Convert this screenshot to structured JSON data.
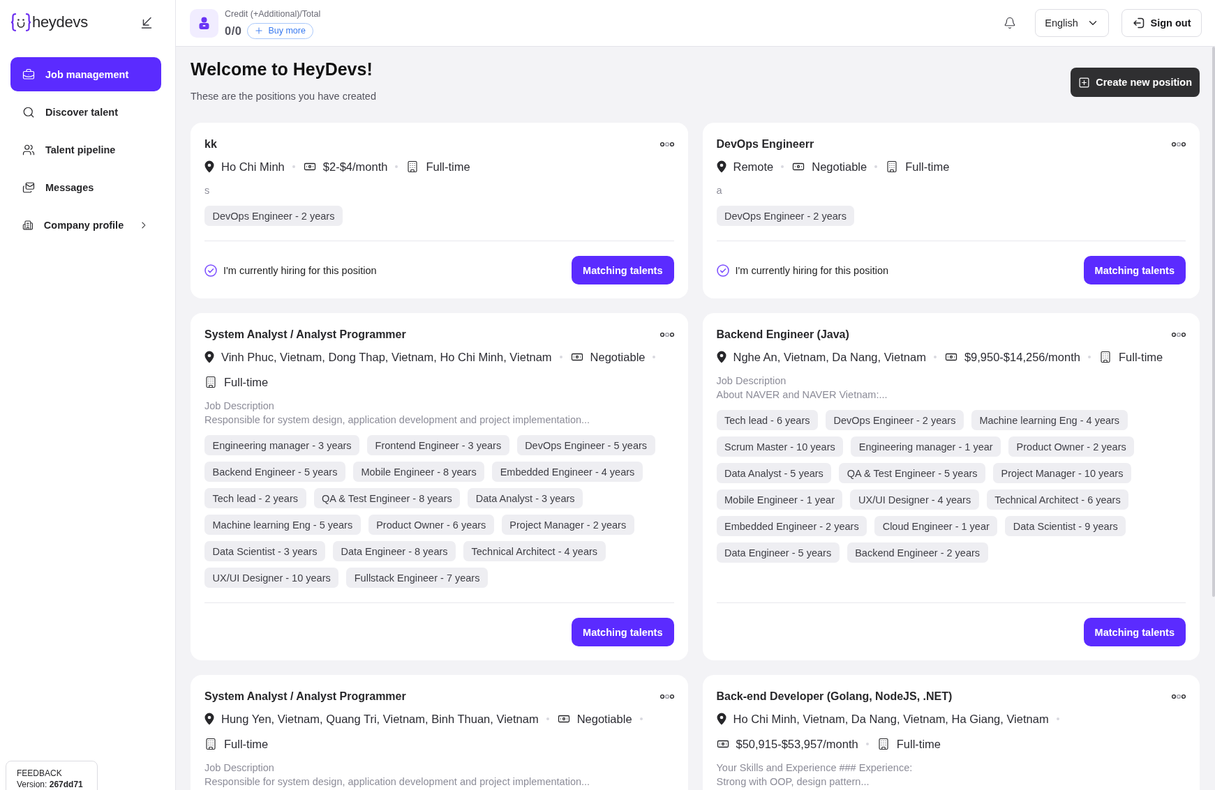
{
  "sidebar": {
    "brand": "heydevs",
    "items": [
      {
        "label": "Job management",
        "selected": true,
        "has_submenu": false
      },
      {
        "label": "Discover talent",
        "selected": false,
        "has_submenu": false
      },
      {
        "label": "Talent pipeline",
        "selected": false,
        "has_submenu": false
      },
      {
        "label": "Messages",
        "selected": false,
        "has_submenu": false
      },
      {
        "label": "Company profile",
        "selected": false,
        "has_submenu": true
      }
    ],
    "feedback": {
      "label": "FEEDBACK",
      "version": "Version: **267dd71**"
    }
  },
  "top_bar": {
    "credit": {
      "label": "Credit (+Additional)/Total",
      "value": "0/0",
      "buy_button": "Buy more"
    },
    "language": "English",
    "sign_out": "Sign out"
  },
  "header": {
    "title": "Welcome to HeyDevs!",
    "subtitle": "These are the positions you have created",
    "create_button": "Create new position"
  },
  "positions": [
    {
      "title": "kk",
      "meta": [
        {
          "kind": "location",
          "text": "Ho Chi Minh"
        },
        {
          "kind": "salary",
          "text": "$2-$4/month"
        },
        {
          "kind": "schedule",
          "text": "Full-time"
        }
      ],
      "description": "s",
      "skills": [
        "DevOps Engineer - 2 years"
      ],
      "hiring": {
        "label": "I'm currently hiring for this position",
        "checked": true
      },
      "button": "Matching talents"
    },
    {
      "title": "DevOps Engineerr",
      "meta": [
        {
          "kind": "location",
          "text": "Remote"
        },
        {
          "kind": "salary",
          "text": "Negotiable"
        },
        {
          "kind": "schedule",
          "text": "Full-time"
        }
      ],
      "description": "a",
      "skills": [
        "DevOps Engineer - 2 years"
      ],
      "hiring": {
        "label": "I'm currently hiring for this position",
        "checked": true
      },
      "button": "Matching talents"
    },
    {
      "title": "System Analyst / Analyst Programmer",
      "meta": [
        {
          "kind": "location",
          "text": "Vinh Phuc, Vietnam, Dong Thap, Vietnam, Ho Chi Minh, Vietnam"
        },
        {
          "kind": "salary",
          "text": "Negotiable"
        },
        {
          "kind": "schedule",
          "text": "Full-time"
        }
      ],
      "description": "Job Description\nResponsible for system design, application development and project implementation...",
      "skills": [
        "Engineering manager - 3 years",
        "Frontend Engineer - 3 years",
        "DevOps Engineer - 5 years",
        "Backend Engineer - 5 years",
        "Mobile Engineer - 8 years",
        "Embedded Engineer - 4 years",
        "Tech lead - 2 years",
        "QA & Test Engineer - 8 years",
        "Data Analyst - 3 years",
        "Machine learning Eng - 5 years",
        "Product Owner - 6 years",
        "Project Manager - 2 years",
        "Data Scientist - 3 years",
        "Data Engineer - 8 years",
        "Technical Architect - 4 years",
        "UX/UI Designer - 10 years",
        "Fullstack Engineer - 7 years"
      ],
      "button": "Matching talents"
    },
    {
      "title": "Backend Engineer (Java)",
      "meta": [
        {
          "kind": "location",
          "text": "Nghe An, Vietnam, Da Nang, Vietnam"
        },
        {
          "kind": "salary",
          "text": "$9,950-$14,256/month"
        },
        {
          "kind": "schedule",
          "text": "Full-time"
        }
      ],
      "description": "Job Description\nAbout NAVER and NAVER Vietnam:...",
      "skills": [
        "Tech lead - 6 years",
        "DevOps Engineer - 2 years",
        "Machine learning Eng - 4 years",
        "Scrum Master - 10 years",
        "Engineering manager - 1 year",
        "Product Owner - 2 years",
        "Data Analyst - 5 years",
        "QA & Test Engineer - 5 years",
        "Project Manager - 10 years",
        "Mobile Engineer - 1 year",
        "UX/UI Designer - 4 years",
        "Technical Architect - 6 years",
        "Embedded Engineer - 2 years",
        "Cloud Engineer - 1 year",
        "Data Scientist - 9 years",
        "Data Engineer - 5 years",
        "Backend Engineer - 2 years"
      ],
      "button": "Matching talents"
    },
    {
      "title": "System Analyst / Analyst Programmer",
      "meta": [
        {
          "kind": "location",
          "text": "Hung Yen, Vietnam, Quang Tri, Vietnam, Binh Thuan, Vietnam"
        },
        {
          "kind": "salary",
          "text": "Negotiable"
        },
        {
          "kind": "schedule",
          "text": "Full-time"
        }
      ],
      "description": "Job Description\nResponsible for system design, application development and project implementation..."
    },
    {
      "title": "Back-end Developer (Golang, NodeJS, .NET)",
      "meta": [
        {
          "kind": "location",
          "text": "Ho Chi Minh, Vietnam, Da Nang, Vietnam, Ha Giang, Vietnam"
        },
        {
          "kind": "salary",
          "text": "$50,915-$53,957/month"
        },
        {
          "kind": "schedule",
          "text": "Full-time"
        }
      ],
      "description": "Your Skills and Experience ### Experience:\nStrong with OOP, design pattern..."
    }
  ]
}
